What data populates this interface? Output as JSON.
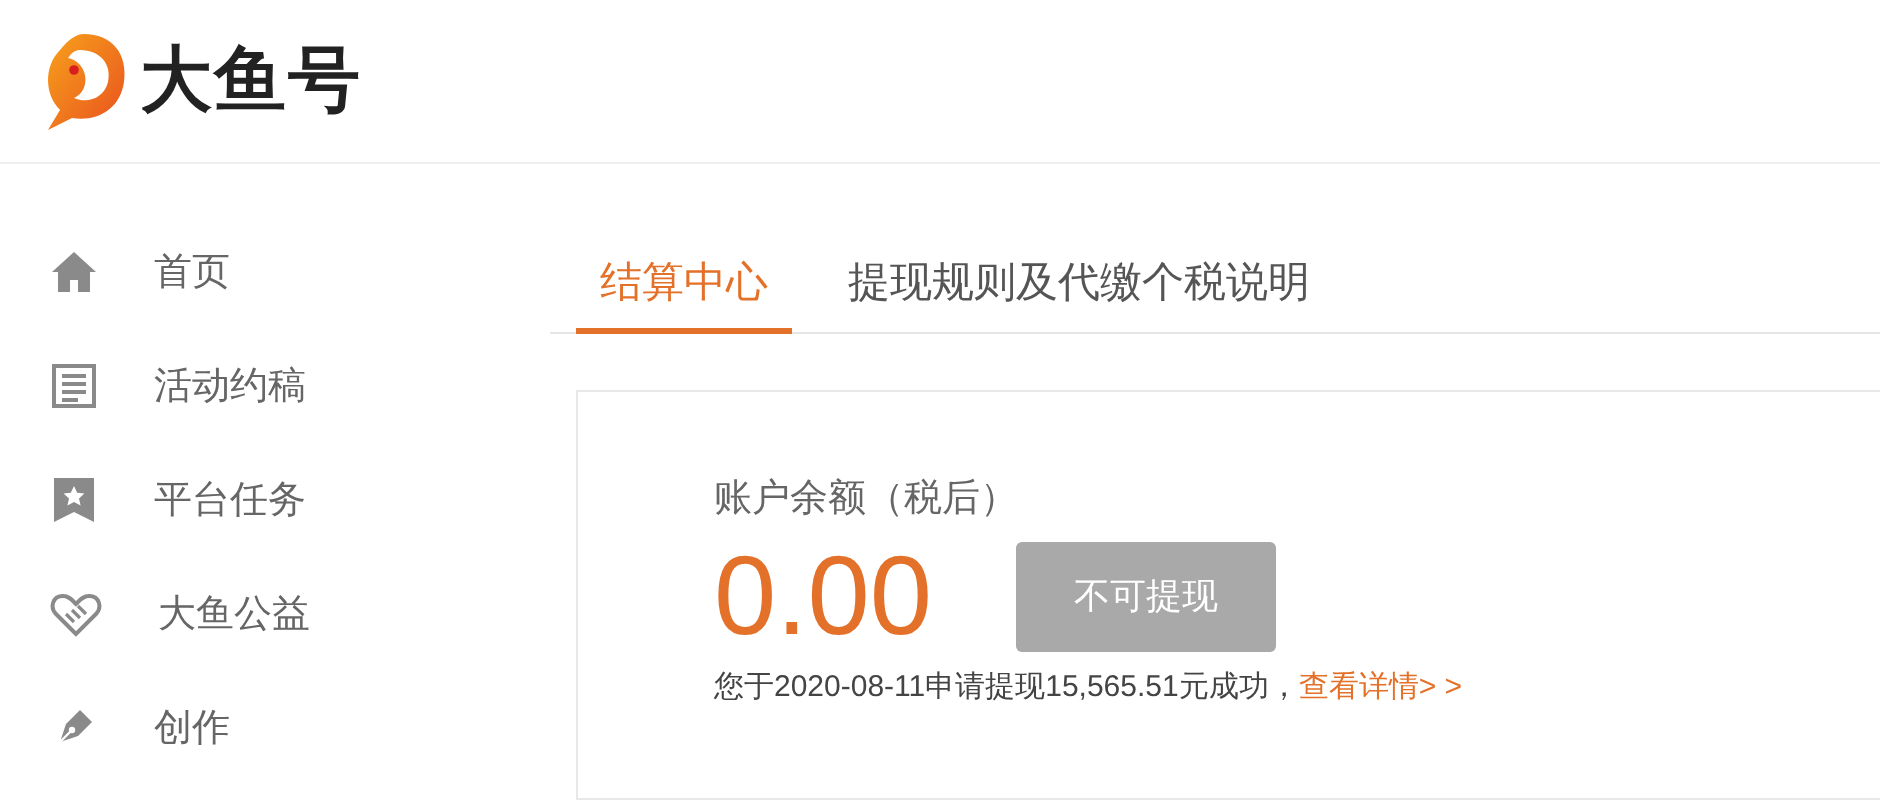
{
  "logo": {
    "text": "大鱼号"
  },
  "sidebar": {
    "items": [
      {
        "label": "首页",
        "kind": "home"
      },
      {
        "label": "活动约稿",
        "kind": "article"
      },
      {
        "label": "平台任务",
        "kind": "task"
      },
      {
        "label": "大鱼公益",
        "kind": "charity"
      },
      {
        "label": "创作",
        "kind": "create"
      }
    ]
  },
  "tabs": [
    {
      "label": "结算中心",
      "selected": true
    },
    {
      "label": "提现规则及代缴个税说明",
      "selected": false
    }
  ],
  "balance": {
    "label": "账户余额（税后）",
    "amount": "0.00",
    "button": {
      "label": "不可提现",
      "disabled": true
    },
    "notice": "您于2020-08-11申请提现15,565.51元成功，",
    "link": "查看详情> >"
  }
}
